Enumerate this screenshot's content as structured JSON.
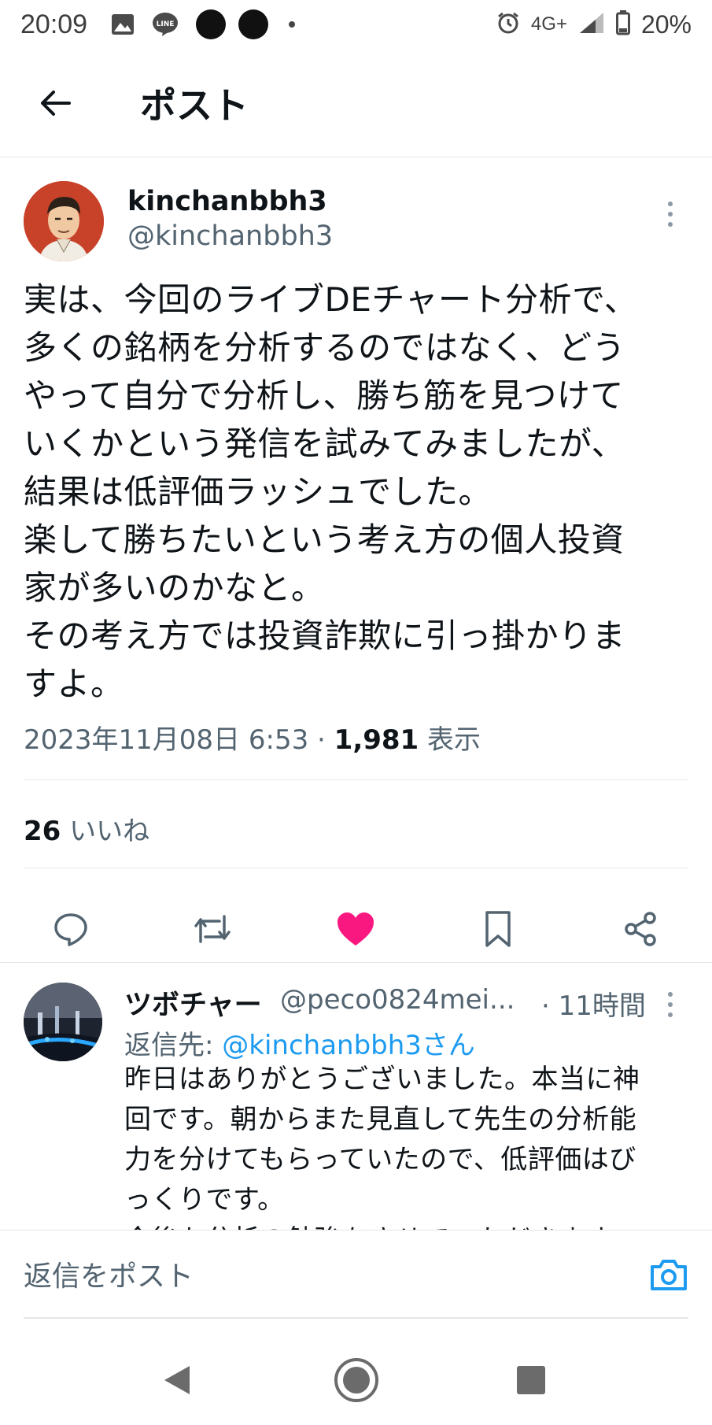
{
  "status_bar": {
    "time": "20:09",
    "network": "4G+",
    "battery": "20%",
    "icons": [
      "image-icon",
      "line-icon",
      "alarm-icon",
      "signal-icon",
      "battery-icon"
    ]
  },
  "header": {
    "title": "ポスト",
    "back_icon": "arrow-left-icon"
  },
  "tweet": {
    "author_name": "kinchanbbh3",
    "author_handle": "@kinchanbbh3",
    "text": "実は、今回のライブDEチャート分析で、\n多くの銘柄を分析するのではなく、どう\nやって自分で分析し、勝ち筋を見つけて\nいくかという発信を試みてみましたが、\n結果は低評価ラッシュでした。\n楽して勝ちたいという考え方の個人投資\n家が多いのかなと。\nその考え方では投資詐欺に引っ掛かりま\nすよ。",
    "timestamp": "2023年11月08日 6:53",
    "separator": " · ",
    "views_count": "1,981",
    "views_label": "表示",
    "likes_count": "26",
    "likes_label": "いいね"
  },
  "actions": {
    "icons": [
      "reply-icon",
      "retweet-icon",
      "heart-filled-icon",
      "bookmark-icon",
      "share-icon"
    ],
    "like_color": "#f91880",
    "icon_color": "#536471"
  },
  "reply": {
    "author_name": "ツボチャー",
    "author_handle": "@peco0824mei...",
    "time": "· 11時間",
    "reply_to_label": "返信先: ",
    "reply_to_handle": "@kinchanbbh3さん",
    "text": "昨日はありがとうございました。本当に神\n回です。朝からまた見直して先生の分析能\n力を分けてもらっていたので、低評価はび\nっくりです。\n今後も分析の勉強をさせていただきます。"
  },
  "compose": {
    "placeholder": "返信をポスト",
    "camera_icon": "camera-icon",
    "accent": "#1d9bf0"
  },
  "navbar": {
    "icons": [
      "nav-back-icon",
      "nav-home-icon",
      "nav-recents-icon"
    ]
  }
}
